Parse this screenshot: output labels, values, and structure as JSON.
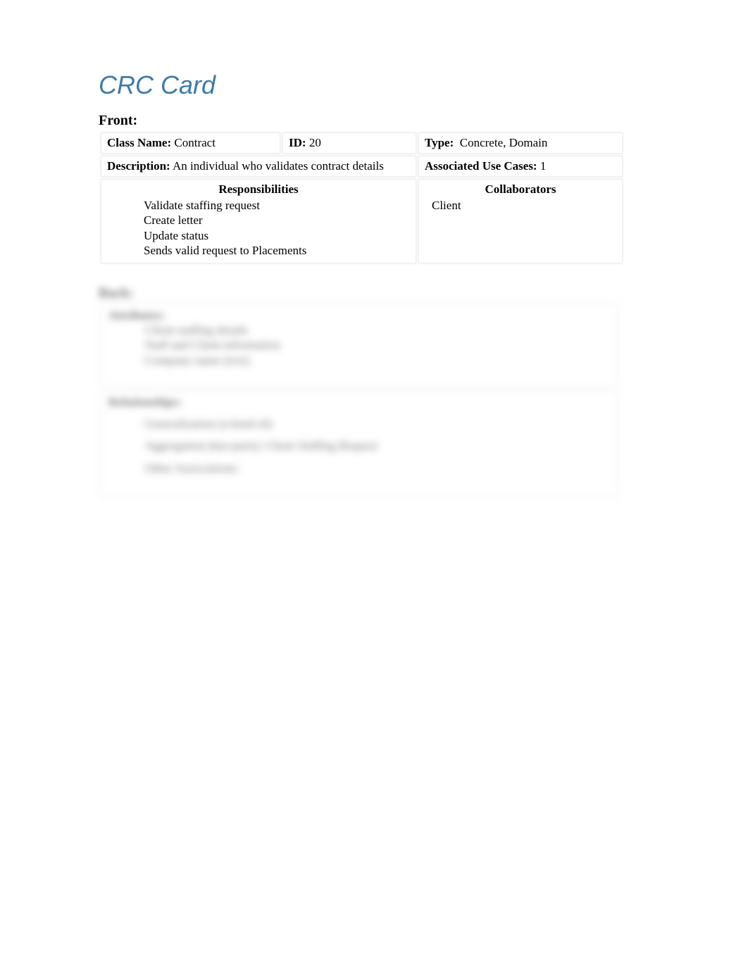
{
  "title": "CRC Card",
  "front": {
    "heading": "Front:",
    "className": {
      "label": "Class Name:",
      "value": "Contract"
    },
    "id": {
      "label": "ID:",
      "value": "20"
    },
    "type": {
      "label": "Type:",
      "value": "Concrete, Domain"
    },
    "description": {
      "label": "Description:",
      "value": "An individual who validates contract details"
    },
    "useCases": {
      "label": "Associated Use Cases:",
      "value": "1"
    },
    "responsibilitiesHeader": "Responsibilities",
    "collaboratorsHeader": "Collaborators",
    "responsibilities": [
      "Validate staffing request",
      "Create letter",
      "Update status",
      "Sends valid request to Placements"
    ],
    "collaborators": [
      "Client"
    ]
  },
  "back": {
    "heading": "Back:",
    "attributesHeader": "Attributes:",
    "attributes": [
      "Client staffing details",
      "Staff and Client information",
      "Company name (text)"
    ],
    "relationshipsHeader": "Relationships:",
    "relationships": [
      "Generalization (a-kind-of):",
      "Aggregation (has-parts):    Client Staffing Request",
      "Other Associations:"
    ]
  }
}
